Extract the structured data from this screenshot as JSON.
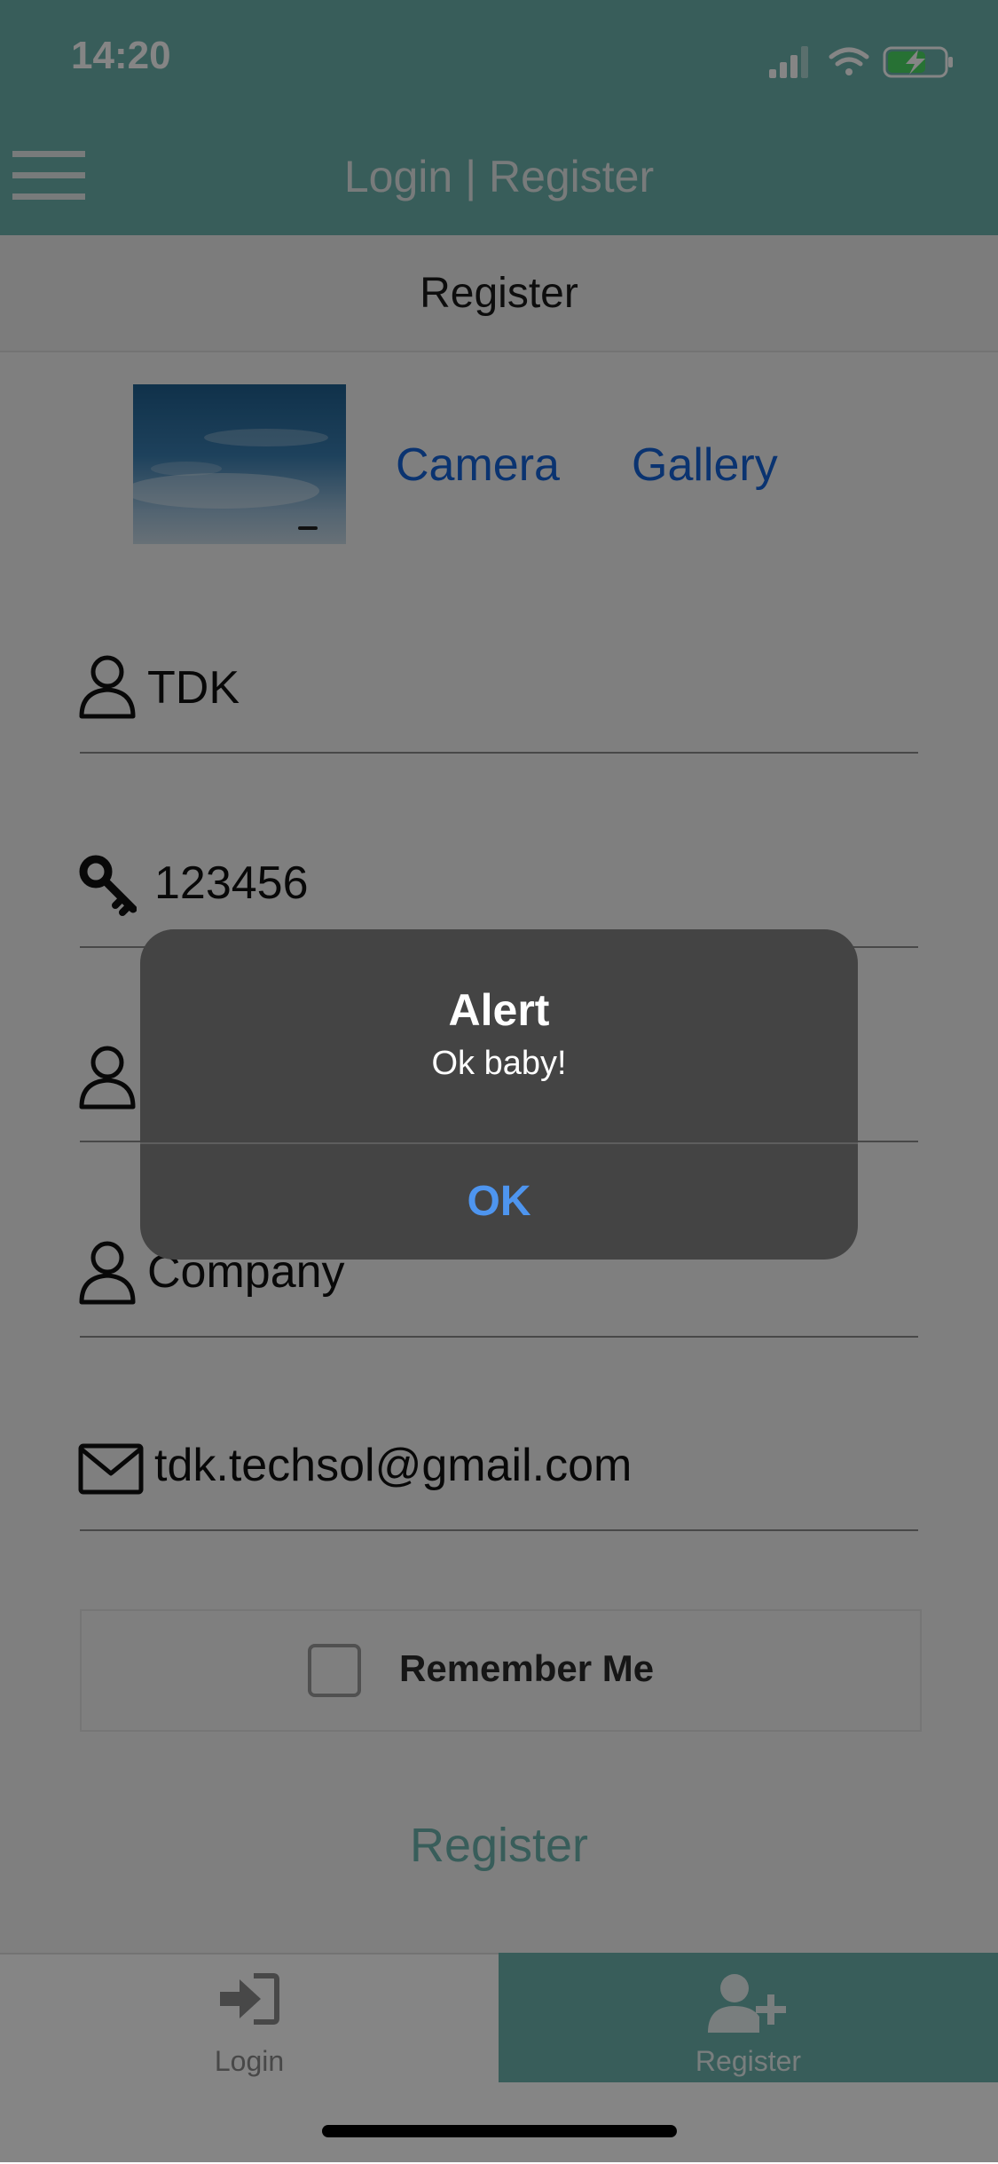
{
  "status_bar": {
    "time": "14:20",
    "icons": [
      "signal-icon",
      "wifi-icon",
      "battery-charging-icon"
    ]
  },
  "header": {
    "title": "Login | Register",
    "menu_icon": "hamburger-menu-icon"
  },
  "tab_header": {
    "label": "Register"
  },
  "photo_section": {
    "camera_label": "Camera",
    "gallery_label": "Gallery"
  },
  "fields": [
    {
      "icon": "user-icon",
      "value": "TDK"
    },
    {
      "icon": "key-icon",
      "value": "123456"
    },
    {
      "icon": "user-icon",
      "value": ""
    },
    {
      "icon": "user-icon",
      "value": "Company"
    },
    {
      "icon": "mail-icon",
      "value": "tdk.techsol@gmail.com"
    }
  ],
  "remember_me": {
    "label": "Remember Me",
    "checked": false
  },
  "register_button": {
    "label": "Register"
  },
  "bottom_tabs": [
    {
      "label": "Login",
      "icon": "login-icon",
      "active": false
    },
    {
      "label": "Register",
      "icon": "add-user-icon",
      "active": true
    }
  ],
  "alert": {
    "title": "Alert",
    "message": "Ok baby!",
    "button_label": "OK"
  },
  "colors": {
    "accent": "#6bb3ad",
    "link": "#1463d6",
    "alert_button": "#4e95ef"
  }
}
